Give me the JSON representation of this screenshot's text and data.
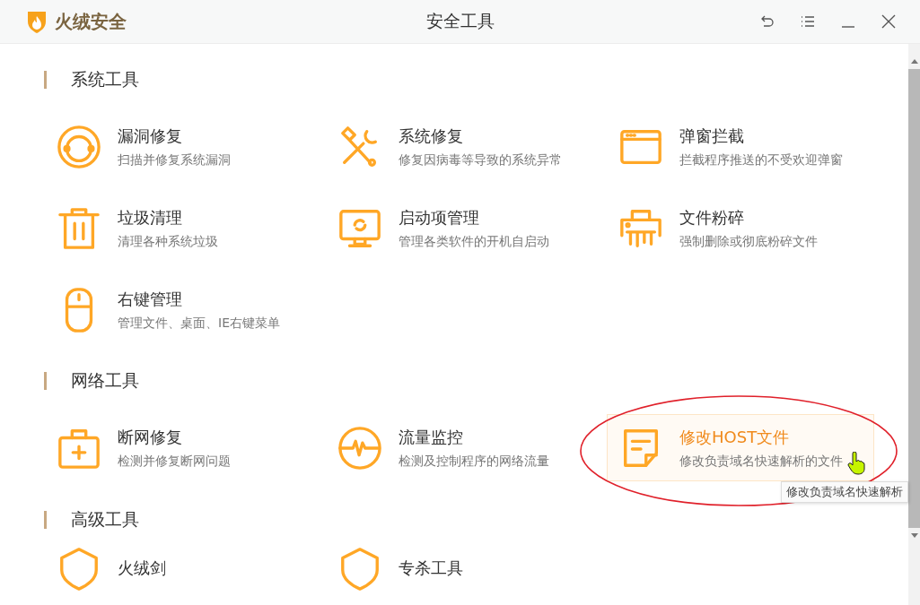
{
  "window": {
    "logo_text": "火绒安全",
    "title": "安全工具"
  },
  "sections": [
    {
      "title": "系统工具",
      "items": [
        {
          "name": "漏洞修复",
          "description": "扫描并修复系统漏洞",
          "hovered": false
        },
        {
          "name": "系统修复",
          "description": "修复因病毒等导致的系统异常",
          "hovered": false
        },
        {
          "name": "弹窗拦截",
          "description": "拦截程序推送的不受欢迎弹窗",
          "hovered": false
        },
        {
          "name": "垃圾清理",
          "description": "清理各种系统垃圾",
          "hovered": false
        },
        {
          "name": "启动项管理",
          "description": "管理各类软件的开机自启动",
          "hovered": false
        },
        {
          "name": "文件粉碎",
          "description": "强制删除或彻底粉碎文件",
          "hovered": false
        },
        {
          "name": "右键管理",
          "description": "管理文件、桌面、IE右键菜单",
          "hovered": false
        }
      ]
    },
    {
      "title": "网络工具",
      "items": [
        {
          "name": "断网修复",
          "description": "检测并修复断网问题",
          "hovered": false
        },
        {
          "name": "流量监控",
          "description": "检测及控制程序的网络流量",
          "hovered": false
        },
        {
          "name": "修改HOST文件",
          "description": "修改负责域名快速解析的文件",
          "hovered": true
        }
      ]
    },
    {
      "title": "高级工具",
      "items": [
        {
          "name": "火绒剑",
          "hovered": false
        },
        {
          "name": "专杀工具",
          "hovered": false
        }
      ]
    }
  ],
  "tooltip": "修改负责域名快速解析"
}
